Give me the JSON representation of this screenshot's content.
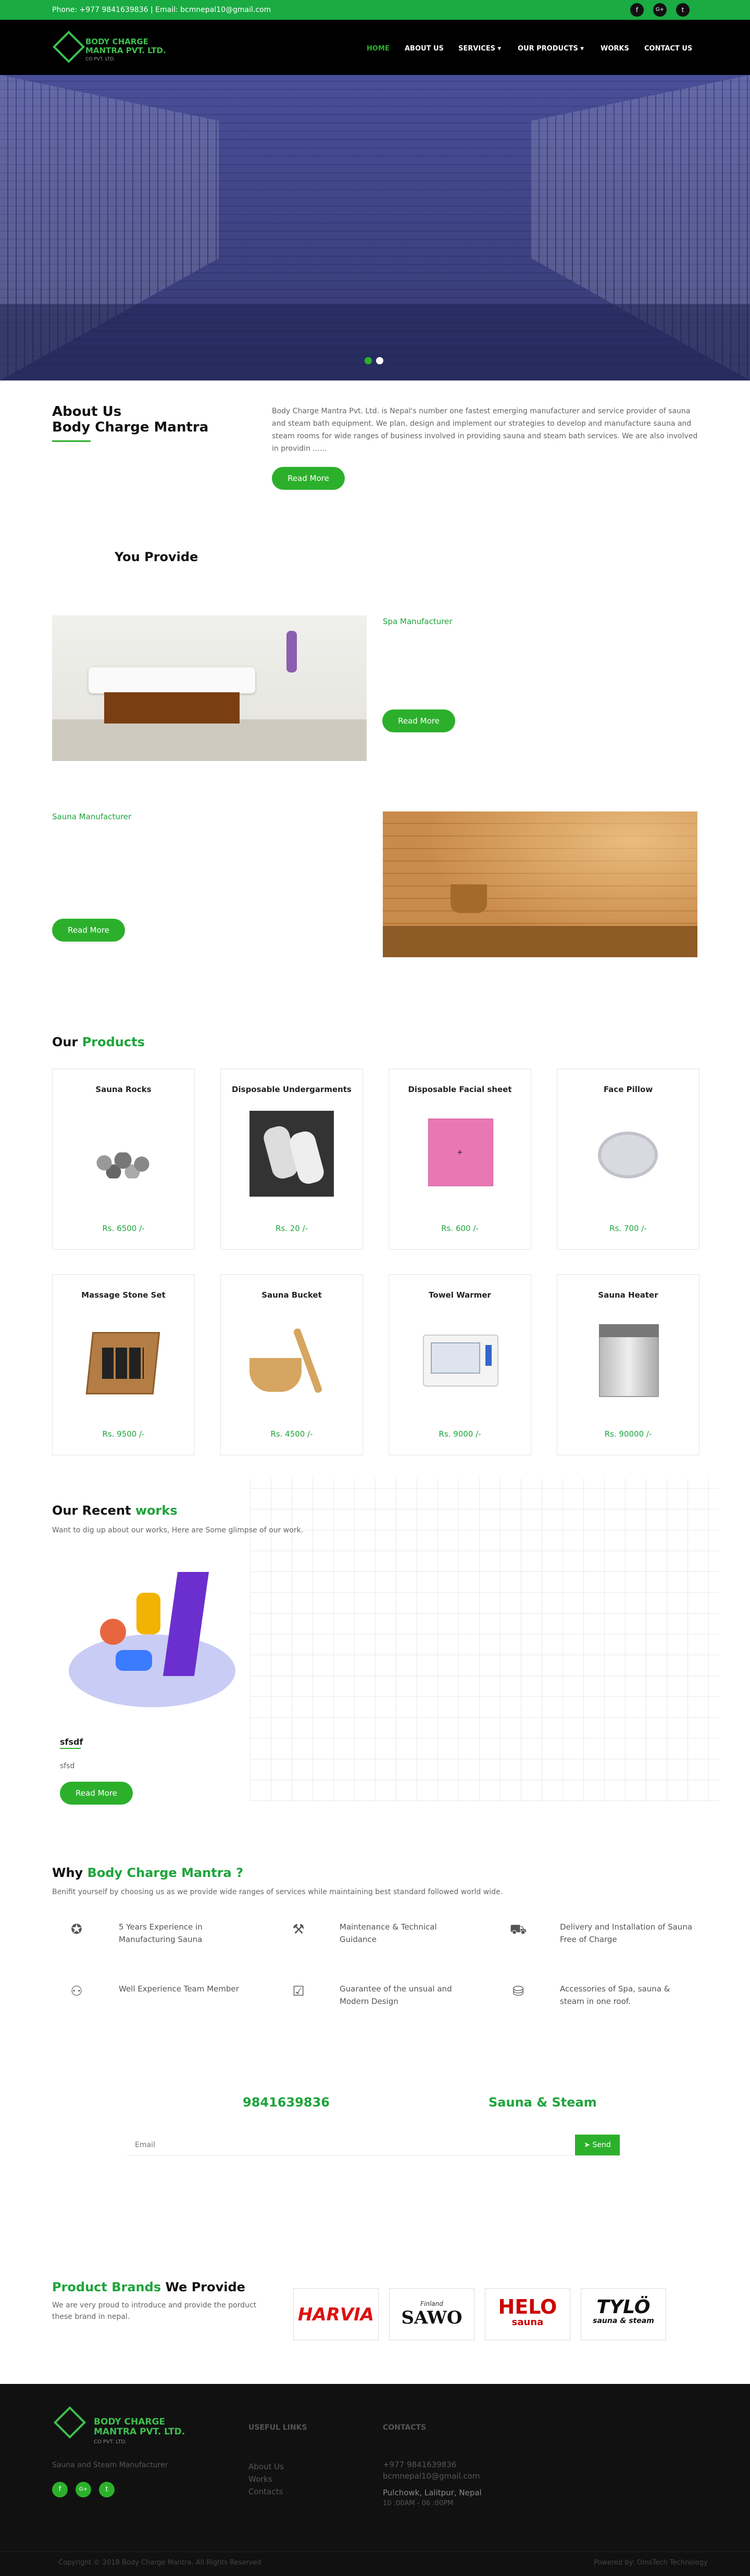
{
  "topbar": {
    "contact": "Phone: +977 9841639836  |  Email: bcmnepal10@gmail.com",
    "social": [
      "f",
      "G+",
      "t"
    ]
  },
  "logo": {
    "line1": "BODY CHARGE",
    "line2": "MANTRA PVT. LTD.",
    "tagline": "CO PVT. LTD."
  },
  "nav": [
    "HOME",
    "ABOUT US",
    "SERVICES ▾",
    "OUR PRODUCTS ▾",
    "WORKS",
    "CONTACT US"
  ],
  "about": {
    "title": "About Us",
    "subtitle": "Body Charge Mantra",
    "text": "Body Charge Mantra Pvt. Ltd. is Nepal's number one fastest emerging manufacturer and service provider of sauna and steam bath equipment. We plan, design and implement our strategies to develop and manufacture sauna and steam rooms for wide ranges of business involved in providing sauna and steam bath services. We are also involved in providin ......",
    "button": "Read More"
  },
  "provide": {
    "title": "You Provide",
    "items": [
      {
        "name": "Spa Manufacturer",
        "button": "Read More"
      },
      {
        "name": "Sauna Manufacturer",
        "button": "Read More"
      }
    ]
  },
  "products": {
    "title_a": "Our ",
    "title_b": "Products",
    "items": [
      {
        "name": "Sauna Rocks",
        "price": "Rs. 6500 /-",
        "icon": "rocks-icon"
      },
      {
        "name": "Disposable Undergarments",
        "price": "Rs. 20 /-",
        "icon": "undergarment-icon"
      },
      {
        "name": "Disposable Facial sheet",
        "price": "Rs. 600 /-",
        "icon": "sheet-icon"
      },
      {
        "name": "Face Pillow",
        "price": "Rs. 700 /-",
        "icon": "pillow-icon"
      },
      {
        "name": "Massage Stone Set",
        "price": "Rs. 9500 /-",
        "icon": "stone-set-icon"
      },
      {
        "name": "Sauna Bucket",
        "price": "Rs. 4500 /-",
        "icon": "bucket-icon"
      },
      {
        "name": "Towel Warmer",
        "price": "Rs. 9000 /-",
        "icon": "towel-warmer-icon"
      },
      {
        "name": "Sauna Heater",
        "price": "Rs. 90000 /-",
        "icon": "heater-icon"
      }
    ]
  },
  "works": {
    "title_a": "Our Recent ",
    "title_b": "works",
    "intro": "Want to dig up about our works, Here are Some glimpse of our work.",
    "item_title": "sfsdf",
    "item_text": "sfsd",
    "button": "Read More"
  },
  "why": {
    "title_a": "Why ",
    "title_b": "Body Charge Mantra ?",
    "intro": "Benifit yourself by choosing us as we provide wide ranges of services while maintaining best standard followed world wide.",
    "features": [
      {
        "icon": "award-icon",
        "glyph": "✪",
        "text": "5 Years Experience in Manufacturing Sauna"
      },
      {
        "icon": "tools-icon",
        "glyph": "⚒",
        "text": "Maintenance & Technical Guidance"
      },
      {
        "icon": "truck-icon",
        "glyph": "⛟",
        "text": "Delivery and Installation of Sauna Free of Charge"
      },
      {
        "icon": "team-icon",
        "glyph": "⚇",
        "text": "Well Experience Team Member"
      },
      {
        "icon": "checklist-icon",
        "glyph": "☑",
        "text": "Guarantee of the unsual and Modern Design"
      },
      {
        "icon": "basket-icon",
        "glyph": "⛁",
        "text": "Accessories of Spa, sauna & steam in one roof."
      }
    ]
  },
  "contact": {
    "phone": "9841639836",
    "tagline": "Sauna & Steam",
    "email_placeholder": "Email",
    "send": "Send"
  },
  "brands": {
    "title_a": "Product Brands",
    "title_b": " We Provide",
    "text": "We are very proud to introduce and provide the porduct these brand in nepal.",
    "logos": [
      {
        "name": "HARVIA",
        "icon": "harvia-logo"
      },
      {
        "name": "SAWO",
        "sub": "Finland",
        "icon": "sawo-logo"
      },
      {
        "name": "HELO",
        "sub": "sauna",
        "icon": "helo-logo"
      },
      {
        "name": "TYLÖ",
        "sub": "sauna & steam",
        "icon": "tylo-logo"
      }
    ]
  },
  "footer": {
    "company_line1": "BODY CHARGE",
    "company_line2": "MANTRA PVT. LTD.",
    "company_tag": "CO PVT. LTD.",
    "about": "Sauna and Steam Manufacturer",
    "useful_head": "USEFUL LINKS",
    "links": [
      "About Us",
      "Works",
      "Contacts"
    ],
    "contacts_head": "CONTACTS",
    "phone": "+977 9841639836",
    "email": "bcmnepal10@gmail.com",
    "address": "Pulchowk, Lalitpur, Nepal",
    "hours": "10 :00AM - 06 :00PM",
    "copyright": "Copyright © 2018 Body Charge Mantra. All Rights Reserved",
    "powered": "Powered by: OmsTech Technology",
    "social": [
      "f",
      "G+",
      "t"
    ]
  }
}
